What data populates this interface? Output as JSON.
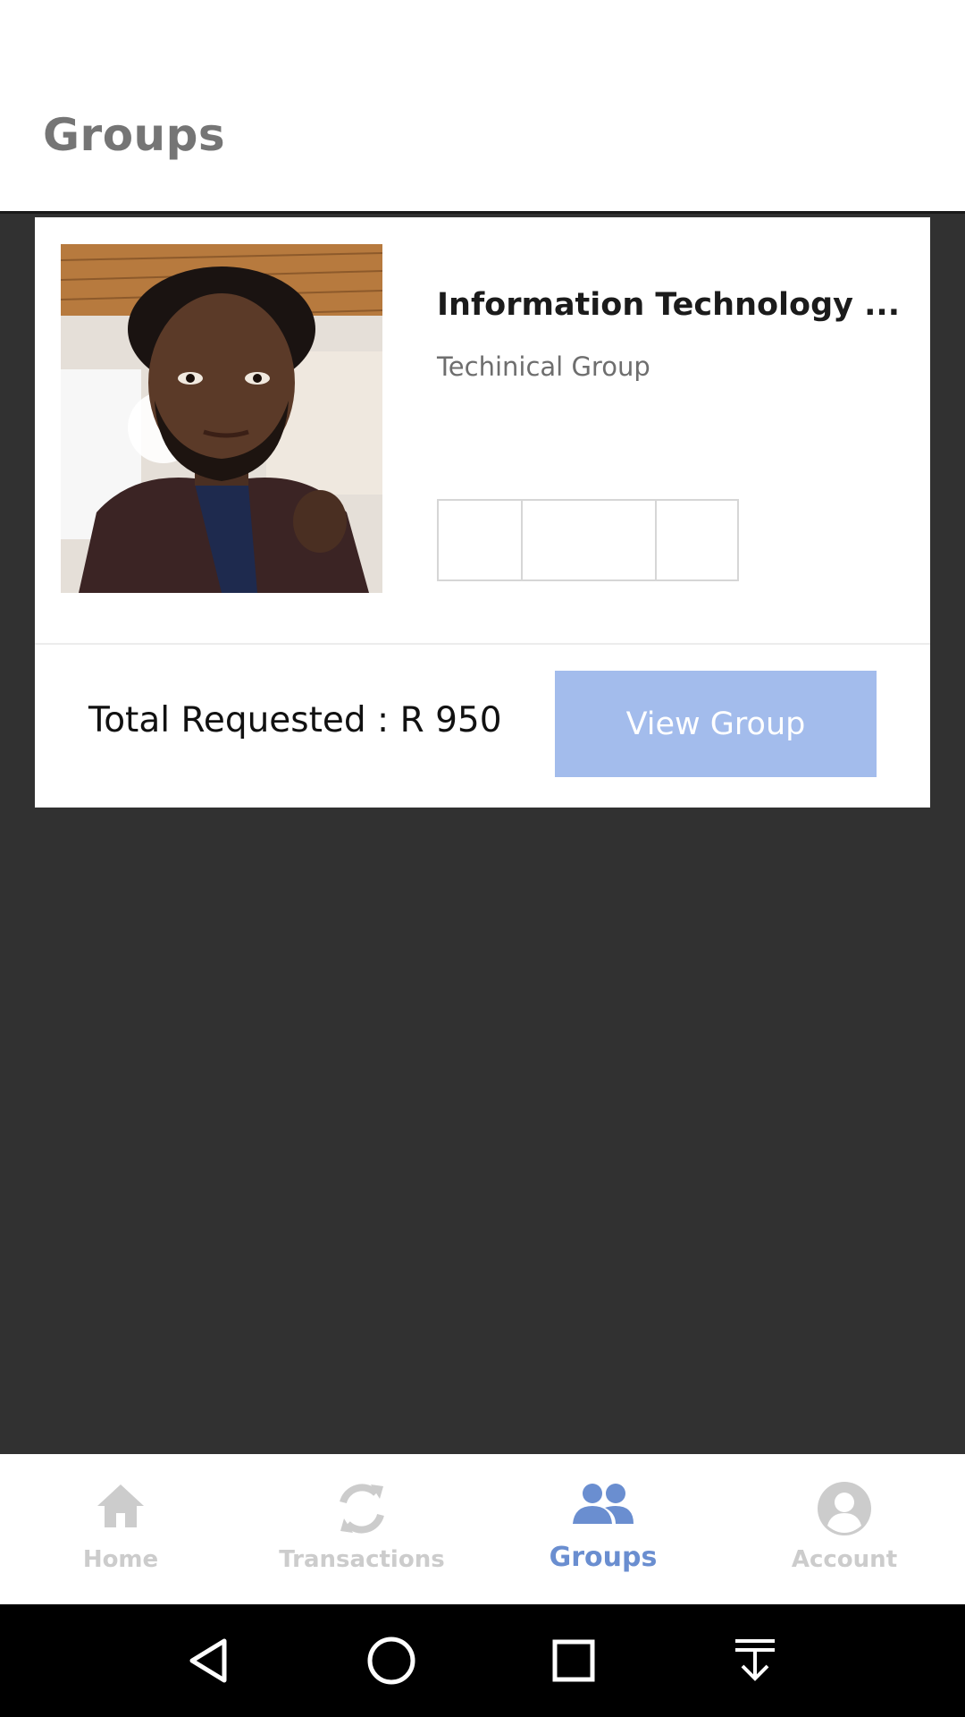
{
  "header": {
    "title": "Groups"
  },
  "group_card": {
    "name": "Information Technology ...",
    "type": "Techinical Group",
    "member_slots": 3,
    "total_requested": "Total Requested : R 950",
    "view_button_label": "View Group",
    "button_color": "#a3bcec"
  },
  "bottom_nav": {
    "items": [
      {
        "label": "Home",
        "icon": "home-icon",
        "active": false
      },
      {
        "label": "Transactions",
        "icon": "refresh-icon",
        "active": false
      },
      {
        "label": "Groups",
        "icon": "groups-icon",
        "active": true
      },
      {
        "label": "Account",
        "icon": "account-icon",
        "active": false
      }
    ],
    "active_color": "#6a8ed0",
    "inactive_color": "#cccccc"
  },
  "system_nav": {
    "buttons": [
      "back-icon",
      "home-circle-icon",
      "recents-icon",
      "notification-pull-icon"
    ]
  }
}
